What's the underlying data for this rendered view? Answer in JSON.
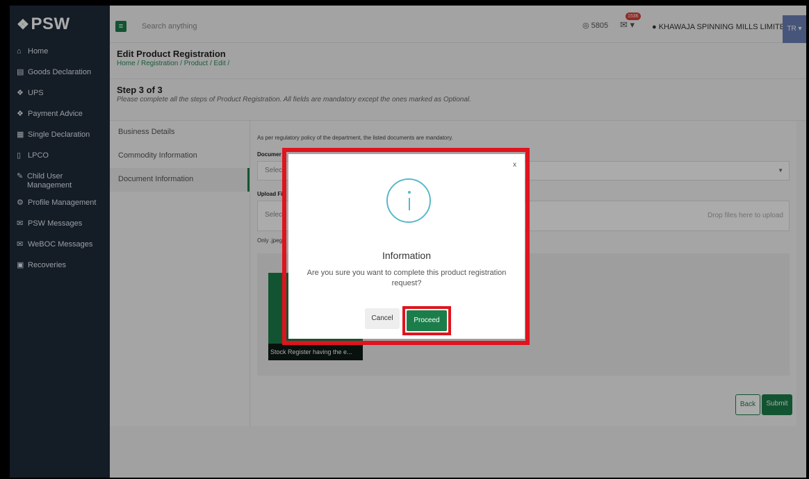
{
  "brand": {
    "logo_text": "PSW"
  },
  "sidebar": {
    "items": [
      {
        "label": "Home",
        "icon": "home-icon"
      },
      {
        "label": "Goods Declaration",
        "icon": "document-icon"
      },
      {
        "label": "UPS",
        "icon": "diamond-icon"
      },
      {
        "label": "Payment Advice",
        "icon": "diamond-icon"
      },
      {
        "label": "Single Declaration",
        "icon": "table-icon"
      },
      {
        "label": "LPCO",
        "icon": "file-icon"
      },
      {
        "label": "Child User Management",
        "icon": "edit-icon"
      },
      {
        "label": "Profile Management",
        "icon": "gear-icon"
      },
      {
        "label": "PSW Messages",
        "icon": "message-icon"
      },
      {
        "label": "WeBOC Messages",
        "icon": "mail-icon"
      },
      {
        "label": "Recoveries",
        "icon": "clipboard-icon"
      }
    ]
  },
  "topbar": {
    "search_placeholder": "Search anything",
    "coins": "5805",
    "notifications": "1536",
    "user": "KHAWAJA SPINNING MILLS LIMITED",
    "avatar": "TR"
  },
  "page": {
    "title": "Edit Product Registration",
    "breadcrumb": "Home / Registration / Product / Edit /"
  },
  "step": {
    "title": "Step 3 of 3",
    "description": "Please complete all the steps of Product Registration. All fields are mandatory except the ones marked as Optional."
  },
  "steps": [
    "Business Details",
    "Commodity Information",
    "Document Information"
  ],
  "form": {
    "note": "As per regulatory policy of the department, the listed documents are mandatory.",
    "document_label": "Documer",
    "document_placeholder": "Select",
    "upload_label": "Upload Fi",
    "upload_placeholder": "Selec",
    "drop_text": "Drop files here to upload",
    "hint": "Only .jpeg",
    "thumb_caption": "Stock Register having the e...",
    "back": "Back",
    "submit": "Submit"
  },
  "modal": {
    "close": "x",
    "title": "Information",
    "text": "Are you sure you want to complete this product registration request?",
    "cancel": "Cancel",
    "proceed": "Proceed"
  }
}
